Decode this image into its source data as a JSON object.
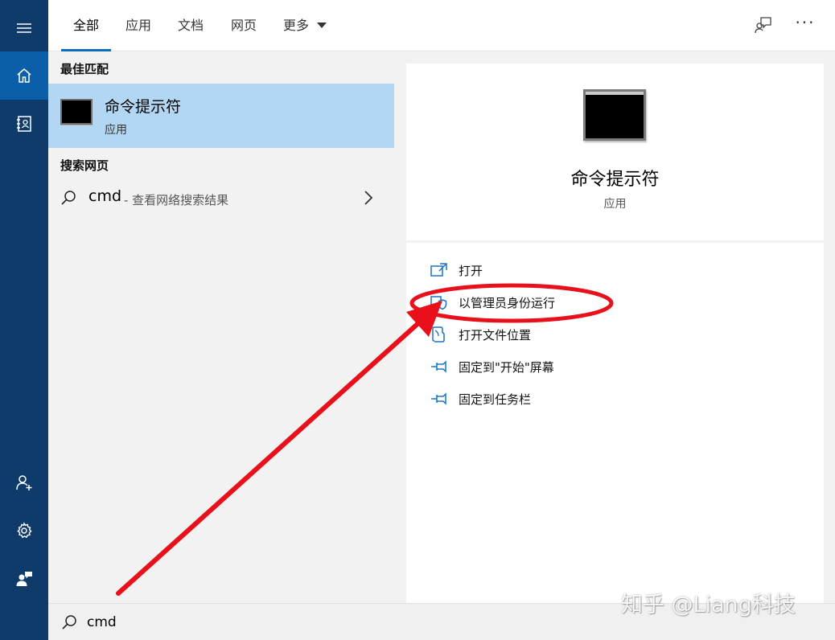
{
  "rail": {
    "items": [
      {
        "icon": "hamburger-menu-icon"
      },
      {
        "icon": "home-icon",
        "active": true
      },
      {
        "icon": "notebook-icon"
      },
      {
        "icon": "account-icon"
      },
      {
        "icon": "gear-icon"
      },
      {
        "icon": "feedback-person-icon"
      }
    ]
  },
  "tabs": {
    "all": "全部",
    "apps": "应用",
    "documents": "文档",
    "web": "网页",
    "more": "更多"
  },
  "results": {
    "best_match_title": "最佳匹配",
    "best_match": {
      "name": "命令提示符",
      "type": "应用"
    },
    "web_title": "搜索网页",
    "web_item": {
      "query": "cmd",
      "suffix": "- 查看网络搜索结果"
    }
  },
  "preview": {
    "name": "命令提示符",
    "type": "应用",
    "actions": [
      {
        "label": "打开",
        "icon": "open-window-icon"
      },
      {
        "label": "以管理员身份运行",
        "icon": "run-as-admin-shield-icon"
      },
      {
        "label": "打开文件位置",
        "icon": "file-location-icon"
      },
      {
        "label": "固定到\"开始\"屏幕",
        "icon": "pin-icon"
      },
      {
        "label": "固定到任务栏",
        "icon": "pin-icon"
      }
    ]
  },
  "search": {
    "value": "cmd"
  },
  "watermark": "知乎 @Liang科技",
  "colors": {
    "rail": "#0e3b6a",
    "rail_active": "#0b5ea8",
    "selected_item": "#b3d7f3",
    "accent": "#0b6cc4",
    "annotation": "#e8101a"
  }
}
